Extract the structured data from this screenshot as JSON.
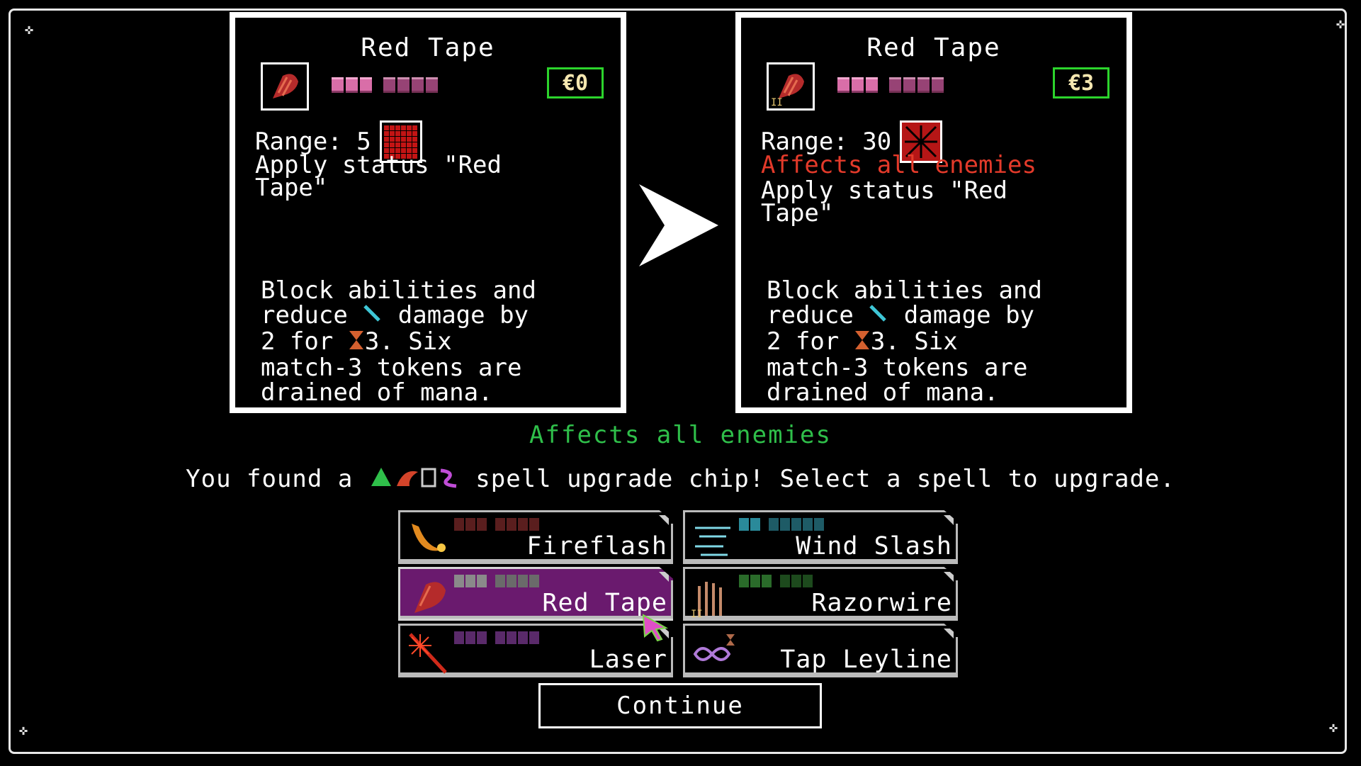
{
  "colors": {
    "accent_green": "#2fbf4a",
    "warning_red": "#e33a2a",
    "selected_purple": "#6a1a6e",
    "cost_border": "#2cd42c"
  },
  "before_card": {
    "title": "Red Tape",
    "icon": "red-tape-icon",
    "cost": "€0",
    "range": "Range: 5",
    "status_line1": "Apply status \"Red",
    "status_line2": "Tape\"",
    "body": "Block abilities and reduce",
    "body2": "damage by",
    "body3": "2 for",
    "body4": "3. Six",
    "body5": "match-3 tokens are",
    "body6": "drained of mana."
  },
  "after_card": {
    "title": "Red Tape",
    "icon": "red-tape-icon",
    "level": "II",
    "cost": "€3",
    "range": "Range: 30",
    "affects": "Affects all enemies",
    "status_line1": "Apply status \"Red",
    "status_line2": "Tape\"",
    "body": "Block abilities and reduce",
    "body2": "damage by",
    "body3": "2 for",
    "body4": "3. Six",
    "body5": "match-3 tokens are",
    "body6": "drained of mana."
  },
  "upgrade_text": "Affects all enemies",
  "found_prefix": "You found a",
  "found_suffix": "spell upgrade chip! Select a spell to upgrade.",
  "spells": [
    {
      "label": "Fireflash",
      "icon": "fireflash-icon"
    },
    {
      "label": "Wind Slash",
      "icon": "wind-slash-icon"
    },
    {
      "label": "Red Tape",
      "icon": "red-tape-icon"
    },
    {
      "label": "Razorwire",
      "icon": "razorwire-icon",
      "level": "II"
    },
    {
      "label": "Laser",
      "icon": "laser-icon"
    },
    {
      "label": "Tap Leyline",
      "icon": "tap-leyline-icon"
    }
  ],
  "continue_label": "Continue"
}
